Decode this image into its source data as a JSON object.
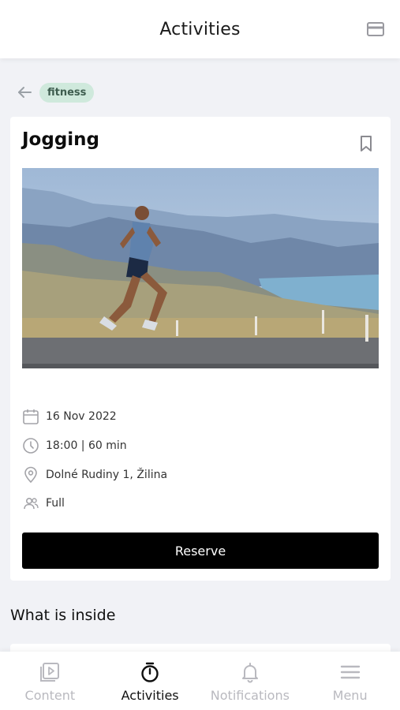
{
  "header": {
    "title": "Activities"
  },
  "breadcrumb": {
    "tag": "fitness"
  },
  "activity": {
    "title": "Jogging",
    "date": "16 Nov 2022",
    "time": "18:00 | 60 min",
    "location": "Dolné Rudiny 1, Žilina",
    "capacity": "Full",
    "reserve_label": "Reserve"
  },
  "section": {
    "title": "What is inside"
  },
  "tabs": [
    {
      "label": "Content",
      "icon": "play-icon"
    },
    {
      "label": "Activities",
      "icon": "stopwatch-icon"
    },
    {
      "label": "Notifications",
      "icon": "bell-icon"
    },
    {
      "label": "Menu",
      "icon": "menu-icon"
    }
  ],
  "colors": {
    "tag_bg": "#cfe9dc",
    "button": "#000000",
    "inactive_tab": "#b9b9bf"
  }
}
